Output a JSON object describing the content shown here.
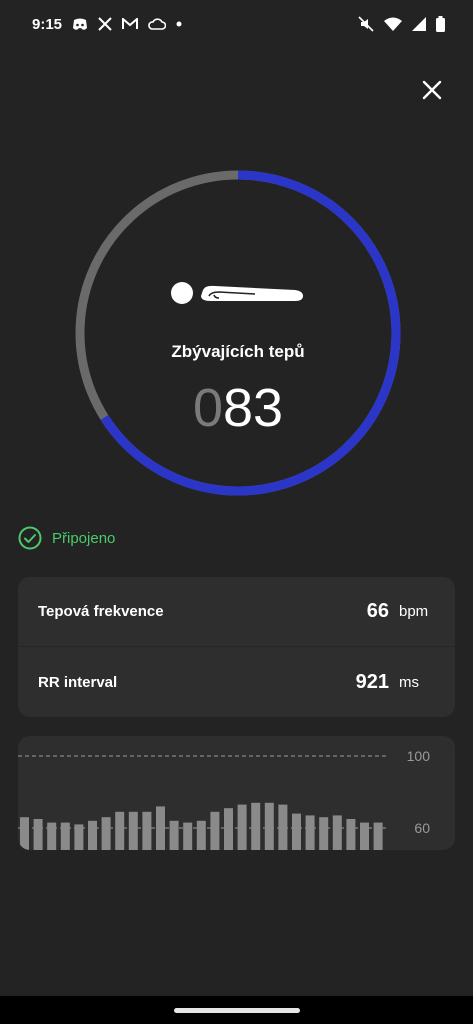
{
  "status_bar": {
    "time": "9:15",
    "left_icons": [
      "discord-icon",
      "x-icon",
      "gmail-icon",
      "cloud-icon",
      "dot-icon"
    ],
    "right_icons": [
      "mute-icon",
      "wifi-icon",
      "signal-icon",
      "battery-icon"
    ]
  },
  "header": {
    "close_icon": "close-icon"
  },
  "ring": {
    "progress_fraction": 0.66,
    "progress_color": "#2b36c9",
    "track_color": "#6a6a6a",
    "posture_icon": "lying-person-icon",
    "label": "Zbývajících tepů",
    "count_leading": "0",
    "count_value": "83"
  },
  "connection": {
    "icon": "check-circle-icon",
    "text": "Připojeno",
    "color": "#4cc96b"
  },
  "metrics": [
    {
      "label": "Tepová frekvence",
      "value": "66",
      "unit": "bpm"
    },
    {
      "label": "RR interval",
      "value": "921",
      "unit": "ms"
    }
  ],
  "chart_data": {
    "type": "bar",
    "ylim": [
      40,
      100
    ],
    "yticks": [
      "100",
      "60"
    ],
    "ytick_values": [
      100,
      60
    ],
    "bar_color": "#8a8a8a",
    "grid": "dashed",
    "values": [
      66,
      65,
      63,
      63,
      62,
      64,
      66,
      69,
      69,
      69,
      72,
      64,
      63,
      64,
      69,
      71,
      73,
      74,
      74,
      73,
      68,
      67,
      66,
      67,
      65,
      63,
      63
    ]
  },
  "nav_bar": {
    "handle": "home-handle"
  }
}
